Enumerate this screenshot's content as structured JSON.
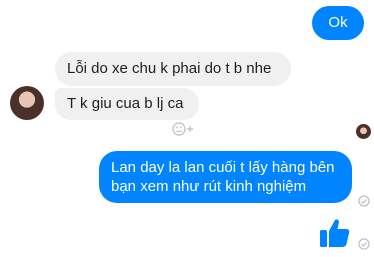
{
  "messages": {
    "out_1": "Ok",
    "in_1": "Lỗi do xe chu k phai do t b nhe",
    "in_2": "T k giu cua b lj ca",
    "out_2": "Lan day la lan cuối t lấy hàng bên bạn xem như rút kinh nghiệm"
  },
  "icons": {
    "sender_avatar": "avatar",
    "read_receipt": "avatar-small",
    "reaction": "smiley-plus-icon",
    "delivered": "check-circle-icon",
    "like": "thumbs-up-icon"
  },
  "colors": {
    "outgoing_bubble": "#0084ff",
    "incoming_bubble": "#f1f0f0",
    "like": "#0084ff"
  }
}
